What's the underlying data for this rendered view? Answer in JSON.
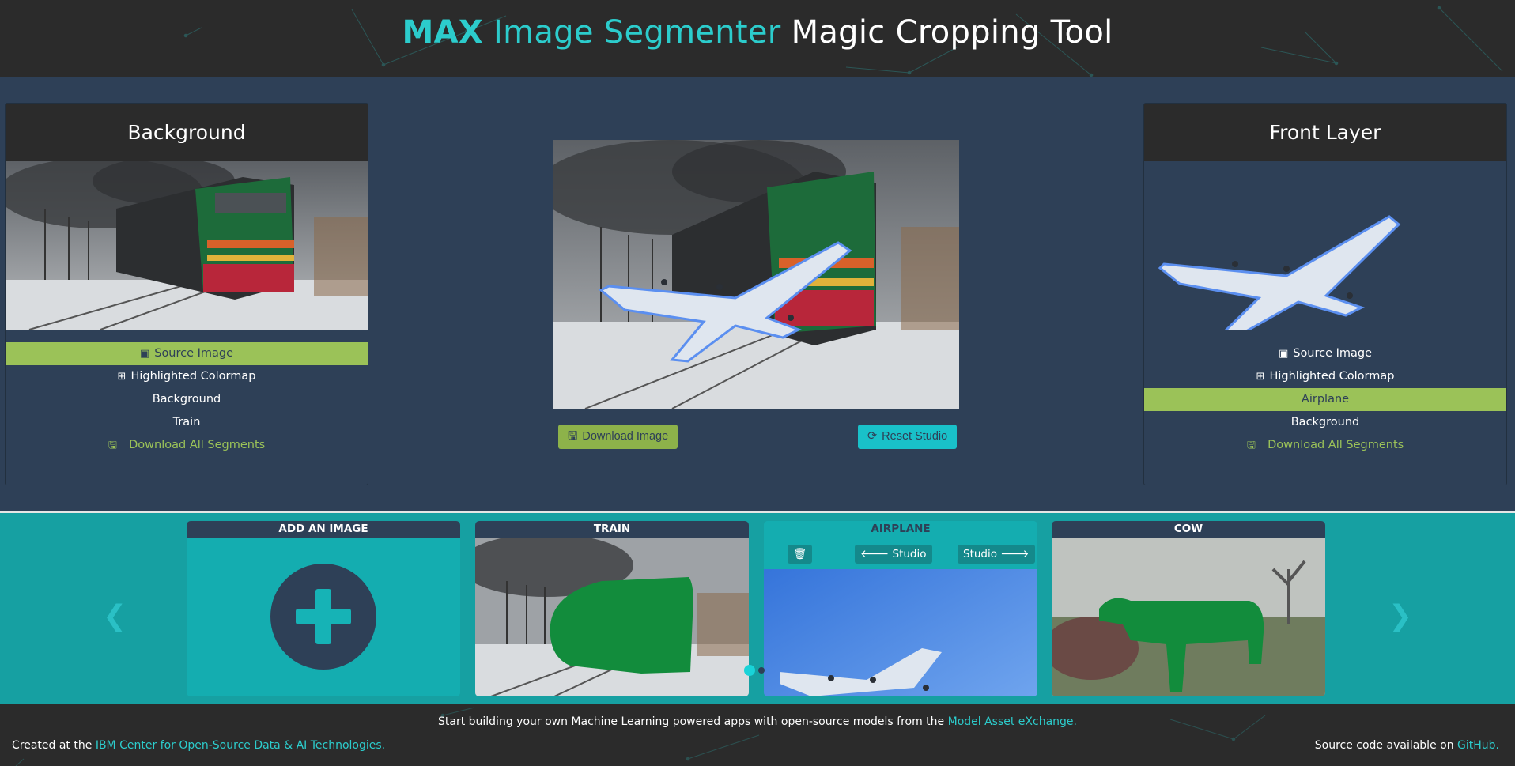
{
  "header": {
    "title_max": "MAX",
    "title_segmenter": "Image Segmenter",
    "title_tool": "Magic Cropping Tool"
  },
  "left_panel": {
    "title": "Background",
    "menu": [
      {
        "label": "Source Image",
        "icon": "image-icon",
        "active": true
      },
      {
        "label": "Highlighted Colormap",
        "icon": "sitemap-icon",
        "active": false
      },
      {
        "label": "Background",
        "active": false
      },
      {
        "label": "Train",
        "active": false
      },
      {
        "label": "Download All Segments",
        "icon": "save-icon",
        "active": false
      }
    ]
  },
  "right_panel": {
    "title": "Front Layer",
    "menu": [
      {
        "label": "Source Image",
        "icon": "image-icon",
        "active": false
      },
      {
        "label": "Highlighted Colormap",
        "icon": "sitemap-icon",
        "active": false
      },
      {
        "label": "Airplane",
        "active": true
      },
      {
        "label": "Background",
        "active": false
      },
      {
        "label": "Download All Segments",
        "icon": "save-icon",
        "active": false
      }
    ]
  },
  "stage": {
    "download_label": "Download Image",
    "reset_label": "Reset Studio"
  },
  "carousel": {
    "cards": [
      {
        "title": "ADD AN IMAGE"
      },
      {
        "title": "TRAIN"
      },
      {
        "title": "AIRPLANE",
        "selected": true,
        "left_studio": "Studio",
        "right_studio": "Studio"
      },
      {
        "title": "COW"
      }
    ]
  },
  "footer": {
    "center_text": "Start building your own Machine Learning powered apps with open-source models from the ",
    "center_link": "Model Asset eXchange.",
    "left_text": "Created at the ",
    "left_link": "IBM Center for Open-Source Data & AI Technologies.",
    "right_text": "Source code available on ",
    "right_link": "GitHub."
  },
  "colors": {
    "accent_teal": "#2ccccc",
    "active_green": "#9bc258",
    "panel_navy": "#2e4057",
    "carousel_teal": "#16a0a2",
    "segment_green": "#128c3c"
  }
}
